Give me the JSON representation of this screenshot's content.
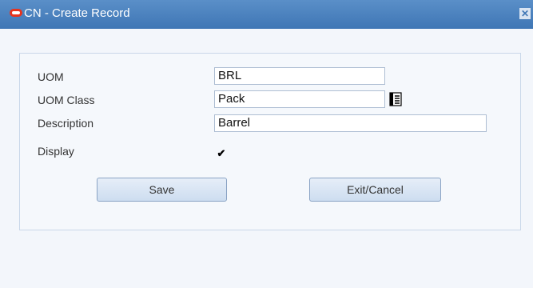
{
  "window": {
    "title": "CN - Create Record",
    "close_glyph": "✕"
  },
  "form": {
    "uom": {
      "label": "UOM",
      "value": "BRL"
    },
    "uom_class": {
      "label": "UOM Class",
      "value": "Pack"
    },
    "description": {
      "label": "Description",
      "value": "Barrel"
    },
    "display": {
      "label": "Display",
      "checked": true,
      "check_glyph": "✔"
    }
  },
  "buttons": {
    "save": "Save",
    "exit_cancel": "Exit/Cancel"
  },
  "colors": {
    "titlebar": "#4a82c0",
    "logo": "#e8331c"
  },
  "icons": {
    "lookup": "list-lookup-icon",
    "close": "close-icon",
    "logo": "oracle-logo-icon"
  }
}
